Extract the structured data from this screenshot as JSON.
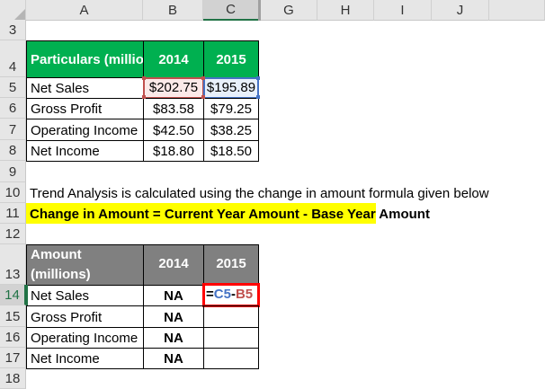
{
  "columns": [
    "A",
    "B",
    "C",
    "G",
    "H",
    "I",
    "J"
  ],
  "rows": [
    "3",
    "4",
    "5",
    "6",
    "7",
    "8",
    "9",
    "10",
    "11",
    "12",
    "13",
    "14",
    "15",
    "16",
    "17",
    "18"
  ],
  "table1": {
    "headers": [
      "Particulars (millions)",
      "2014",
      "2015"
    ],
    "rows": [
      [
        "Net Sales",
        "$202.75",
        "$195.89"
      ],
      [
        "Gross Profit",
        "$83.58",
        "$79.25"
      ],
      [
        "Operating Income",
        "$42.50",
        "$38.25"
      ],
      [
        "Net Income",
        "$18.80",
        "$18.50"
      ]
    ]
  },
  "note": "Trend Analysis is calculated using the change in amount formula given below",
  "formula_text": "Change in Amount = Current Year Amount - Base Year Amount",
  "table2": {
    "headers": [
      "Change In Amount (millions)",
      "2014",
      "2015"
    ],
    "rows": [
      [
        "Net Sales",
        "NA",
        ""
      ],
      [
        "Gross Profit",
        "NA",
        ""
      ],
      [
        "Operating Income",
        "NA",
        ""
      ],
      [
        "Net Income",
        "NA",
        ""
      ]
    ]
  },
  "edit_formula": {
    "eq": "=",
    "ref1": "C5",
    "op": "-",
    "ref2": "B5"
  },
  "colors": {
    "green": "#00b050",
    "gray": "#808080",
    "highlight": "#ffff00",
    "ref_blue": "#4472c4",
    "ref_red": "#c0504d"
  }
}
